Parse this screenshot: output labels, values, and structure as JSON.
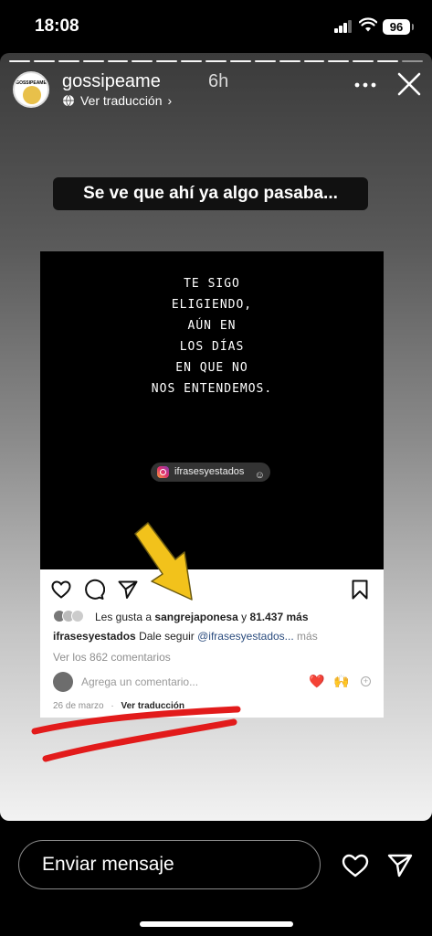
{
  "status_bar": {
    "time": "18:08",
    "battery": "96",
    "icons": [
      "signal-icon",
      "wifi-icon",
      "battery-icon"
    ]
  },
  "story": {
    "progress": {
      "total": 17,
      "viewed": 16
    },
    "username": "gossipeame",
    "time_ago": "6h",
    "translate_label": "Ver traducción",
    "avatar_text": "GOSSIPEAME",
    "caption": "Se ve que ahí ya algo pasaba...",
    "overlay_colors": {
      "arrow": "#f2c21b",
      "underline": "#e21b1b"
    }
  },
  "post": {
    "quote": "TE SIGO\nELIGIENDO,\nAÚN EN\nLOS DÍAS\nEN QUE NO\nNOS ENTENDEMOS.",
    "image_handle": "ifrasesyestados",
    "likes_prefix": "Les gusta a",
    "likes_user": "sangrejaponesa",
    "likes_connector": "y",
    "likes_count": "81.437 más",
    "caption_user": "ifrasesyestados",
    "caption_text": "Dale seguir",
    "caption_mention": "@ifrasesyestados...",
    "caption_more": "más",
    "comments_link": "Ver los 862 comentarios",
    "comment_placeholder": "Agrega un comentario...",
    "comment_emojis": [
      "❤️",
      "🙌"
    ],
    "date": "26 de marzo",
    "separator": "·",
    "translate_label": "Ver traducción"
  },
  "bottom_bar": {
    "message_placeholder": "Enviar mensaje"
  }
}
